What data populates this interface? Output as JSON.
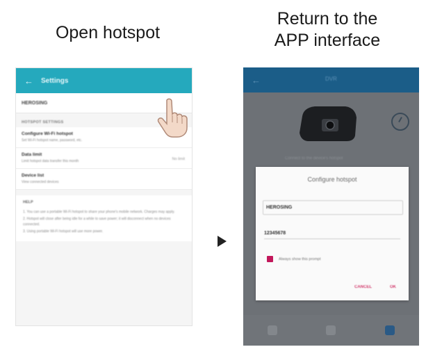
{
  "captions": {
    "left": "Open hotspot",
    "right_line1": "Return to the",
    "right_line2": "APP interface"
  },
  "colors": {
    "settings_bar": "#25a9bd",
    "app_bar": "#1b5d88",
    "accent": "#c2185b"
  },
  "left_phone": {
    "title": "Settings",
    "ssid_row": "HEROSING",
    "section_header": "HOTSPOT SETTINGS",
    "settings": [
      {
        "title": "Configure Wi-Fi hotspot",
        "desc": "Set Wi-Fi hotspot name, password, etc.",
        "value": ""
      },
      {
        "title": "Data limit",
        "desc": "Limit hotspot data transfer this month",
        "value": "No limit"
      },
      {
        "title": "Device list",
        "desc": "View connected devices",
        "value": ""
      }
    ],
    "help_header": "HELP",
    "help_paragraphs": [
      "1. You can use a portable Wi-Fi hotspot to share your phone's mobile network. Charges may apply.",
      "2. Hotspot will close after being idle for a while to save power; it will disconnect when no devices connected.",
      "3. Using portable Wi-Fi hotspot will use more power."
    ]
  },
  "right_phone": {
    "title": "DVR",
    "faint_text": "Connect to the device's hotspot",
    "dialog": {
      "title": "Configure hotspot",
      "ssid_value": "HEROSING",
      "password_value": "12345678",
      "checkbox_label": "Always show this prompt",
      "cancel_label": "CANCEL",
      "ok_label": "OK"
    }
  }
}
